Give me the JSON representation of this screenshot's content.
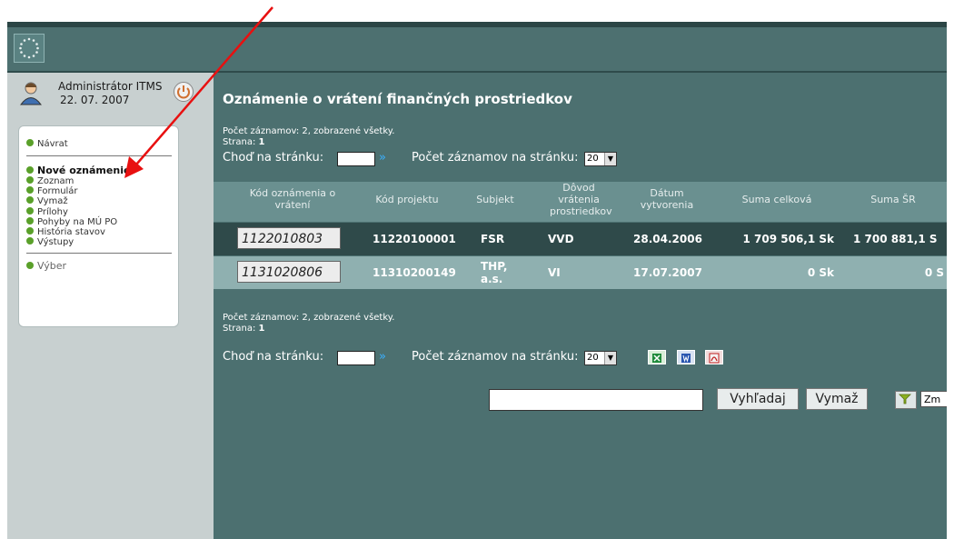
{
  "user": {
    "name": "Administrátor ITMS",
    "date": "22. 07. 2007"
  },
  "menu": {
    "back": "Návrat",
    "items": [
      "Nové oznámenie",
      "Zoznam",
      "Formulár",
      "Vymaž",
      "Prílohy",
      "Pohyby na MÚ PO",
      "História stavov",
      "Výstupy"
    ],
    "select": "Výber"
  },
  "main": {
    "title": "Oznámenie o vrátení finančných prostriedkov",
    "count_label": "Počet záznamov: 2, zobrazené všetky.",
    "page_label": "Strana:",
    "page_value": "1",
    "goto_label": "Choď na stránku:",
    "per_page_label": "Počet záznamov na stránku:",
    "per_page_value": "20"
  },
  "table": {
    "headers": [
      "Kód oznámenia o vrátení",
      "Kód projektu",
      "Subjekt",
      "Dôvod vrátenia prostriedkov",
      "Dátum vytvorenia",
      "Suma celková",
      "Suma ŠR"
    ],
    "rows": [
      {
        "code": "1122010803",
        "project": "11220100001",
        "subject": "FSR",
        "reason": "VVD",
        "date": "28.04.2006",
        "total": "1 709 506,1 Sk",
        "sr": "1 700 881,1 S"
      },
      {
        "code": "1131020806",
        "project": "11310200149",
        "subject": "THP,\na.s.",
        "reason": "VI",
        "date": "17.07.2007",
        "total": "0 Sk",
        "sr": "0 S"
      }
    ]
  },
  "search": {
    "button": "Vyhľadaj",
    "clear": "Vymaž",
    "zm": "Zm"
  },
  "colors": {
    "bg": "#4c7070",
    "header_row": "#6a9090",
    "row_dark": "#2f4a4a",
    "row_light": "#8fb0b0",
    "bullet": "#5aa02a",
    "arrow": "#e81010"
  }
}
